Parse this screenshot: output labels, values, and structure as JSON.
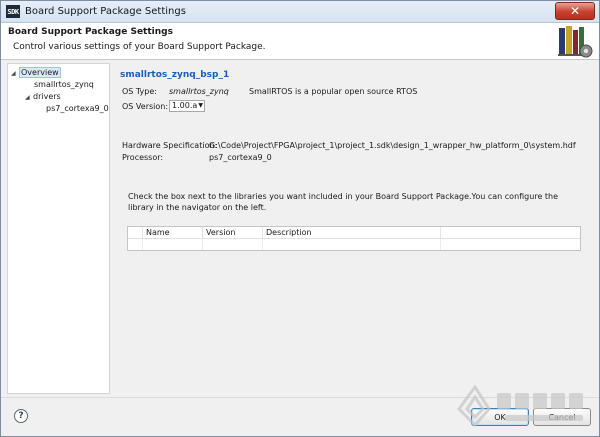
{
  "window": {
    "title": "Board Support Package Settings",
    "app_icon_text": "SDK",
    "close_glyph": "✕"
  },
  "header": {
    "title": "Board Support Package Settings",
    "description": "Control various settings of your Board Support Package."
  },
  "tree": {
    "items": [
      {
        "label": "Overview",
        "expander": "◢",
        "selected": true
      },
      {
        "label": "smallrtos_zynq",
        "expander": ""
      },
      {
        "label": "drivers",
        "expander": "◢"
      },
      {
        "label": "ps7_cortexa9_0",
        "expander": ""
      }
    ]
  },
  "overview": {
    "bsp_name": "smallrtos_zynq_bsp_1",
    "os_type_label": "OS Type:",
    "os_type_value": "smallrtos_zynq",
    "os_description": "SmallRTOS is a popular open source RTOS",
    "os_version_label": "OS Version:",
    "os_version_value": "1.00.a",
    "hw_spec_label": "Hardware Specification:",
    "hw_spec_value": "G:\\Code\\Project\\FPGA\\project_1\\project_1.sdk\\design_1_wrapper_hw_platform_0\\system.hdf",
    "processor_label": "Processor:",
    "processor_value": "ps7_cortexa9_0",
    "hint": "Check the box next to the libraries you want included in your Board Support Package.You can configure the library in the navigator on the left."
  },
  "libraries_table": {
    "columns": [
      "Name",
      "Version",
      "Description"
    ]
  },
  "footer": {
    "help_glyph": "?",
    "ok_label": "OK",
    "cancel_label": "Cancel"
  },
  "colors": {
    "link_blue": "#1a5fb4",
    "selection": "#dbe8f7",
    "close_red": "#c6412d"
  }
}
